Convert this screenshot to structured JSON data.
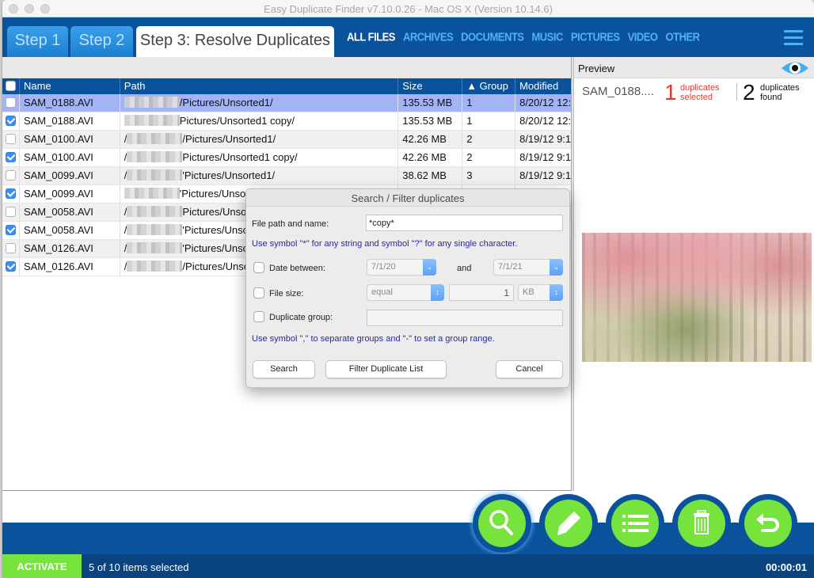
{
  "window": {
    "title": "Easy Duplicate Finder v7.10.0.26 - Mac OS X (Version 10.14.6)"
  },
  "steps": [
    {
      "label": "Step 1",
      "active": false
    },
    {
      "label": "Step 2",
      "active": false
    },
    {
      "label": "Step 3: Resolve Duplicates",
      "active": true
    }
  ],
  "categories": [
    {
      "label": "ALL FILES",
      "active": true
    },
    {
      "label": "ARCHIVES",
      "active": false
    },
    {
      "label": "DOCUMENTS",
      "active": false
    },
    {
      "label": "MUSIC",
      "active": false
    },
    {
      "label": "PICTURES",
      "active": false
    },
    {
      "label": "VIDEO",
      "active": false
    },
    {
      "label": "OTHER",
      "active": false
    }
  ],
  "table": {
    "columns": [
      "",
      "Name",
      "Path",
      "Size",
      "▲ Group",
      "Modified"
    ],
    "rows": [
      {
        "checked": false,
        "name": "SAM_0188.AVI",
        "path_prefix": "",
        "path": "/Pictures/Unsorted1/",
        "size": "135.53 MB",
        "group": "1",
        "modified": "8/20/12 12:",
        "selected": true
      },
      {
        "checked": true,
        "name": "SAM_0188.AVI",
        "path_prefix": "",
        "path": "Pictures/Unsorted1 copy/",
        "size": "135.53 MB",
        "group": "1",
        "modified": "8/20/12 12:",
        "selected": false
      },
      {
        "checked": false,
        "name": "SAM_0100.AVI",
        "path_prefix": "/",
        "path": "/Pictures/Unsorted1/",
        "size": "42.26 MB",
        "group": "2",
        "modified": "8/19/12 9:1",
        "selected": false
      },
      {
        "checked": true,
        "name": "SAM_0100.AVI",
        "path_prefix": "/",
        "path": "Pictures/Unsorted1 copy/",
        "size": "42.26 MB",
        "group": "2",
        "modified": "8/19/12 9:1",
        "selected": false
      },
      {
        "checked": false,
        "name": "SAM_0099.AVI",
        "path_prefix": "/",
        "path": "'Pictures/Unsorted1/",
        "size": "38.62 MB",
        "group": "3",
        "modified": "8/19/12 9:1",
        "selected": false
      },
      {
        "checked": true,
        "name": "SAM_0099.AVI",
        "path_prefix": "",
        "path": "'Pictures/Unsor",
        "size": "",
        "group": "",
        "modified": "",
        "selected": false
      },
      {
        "checked": false,
        "name": "SAM_0058.AVI",
        "path_prefix": "/",
        "path": "Pictures/Unsor",
        "size": "",
        "group": "",
        "modified": "",
        "selected": false
      },
      {
        "checked": true,
        "name": "SAM_0058.AVI",
        "path_prefix": "/",
        "path": "'Pictures/Unsor",
        "size": "",
        "group": "",
        "modified": "",
        "selected": false
      },
      {
        "checked": false,
        "name": "SAM_0126.AVI",
        "path_prefix": "/",
        "path": "'Pictures/Unsor",
        "size": "",
        "group": "",
        "modified": "",
        "selected": false
      },
      {
        "checked": true,
        "name": "SAM_0126.AVI",
        "path_prefix": "/",
        "path": "/Pictures/Unsor",
        "size": "",
        "group": "",
        "modified": "",
        "selected": false
      }
    ]
  },
  "preview": {
    "title": "Preview",
    "filename": "SAM_0188....",
    "duplicates_selected_count": "1",
    "duplicates_selected_label_1": "duplicates",
    "duplicates_selected_label_2": "selected",
    "duplicates_found_count": "2",
    "duplicates_found_label_1": "duplicates",
    "duplicates_found_label_2": "found"
  },
  "dialog": {
    "title": "Search / Filter duplicates",
    "path_label": "File path and name:",
    "path_value": "*copy*",
    "path_hint": "Use symbol \"*\" for any string and symbol \"?\" for any single character.",
    "date_label": "Date between:",
    "date_checked": false,
    "date_from": "7/1/20",
    "date_and": "and",
    "date_to": "7/1/21",
    "size_label": "File size:",
    "size_checked": false,
    "size_operator": "equal",
    "size_value": "1",
    "size_unit": "KB",
    "group_label": "Duplicate group:",
    "group_checked": false,
    "group_value": "",
    "group_hint": "Use symbol \",\" to separate groups and \"-\" to set a group range.",
    "search_button": "Search",
    "filter_button": "Filter Duplicate List",
    "cancel_button": "Cancel"
  },
  "actions": [
    {
      "name": "search",
      "icon": "search-icon"
    },
    {
      "name": "edit",
      "icon": "pencil-icon"
    },
    {
      "name": "list",
      "icon": "list-icon"
    },
    {
      "name": "delete",
      "icon": "trash-icon"
    },
    {
      "name": "undo",
      "icon": "undo-icon"
    }
  ],
  "status": {
    "activate_label": "ACTIVATE",
    "selection_text": "5 of 10 items selected",
    "timer": "00:00:01"
  },
  "colors": {
    "brand_blue": "#0b529c",
    "accent_green": "#77e33d",
    "nav_light_blue": "#4fb2f5",
    "selected_row": "#a4b3f4",
    "alert_red": "#e23a2e"
  }
}
